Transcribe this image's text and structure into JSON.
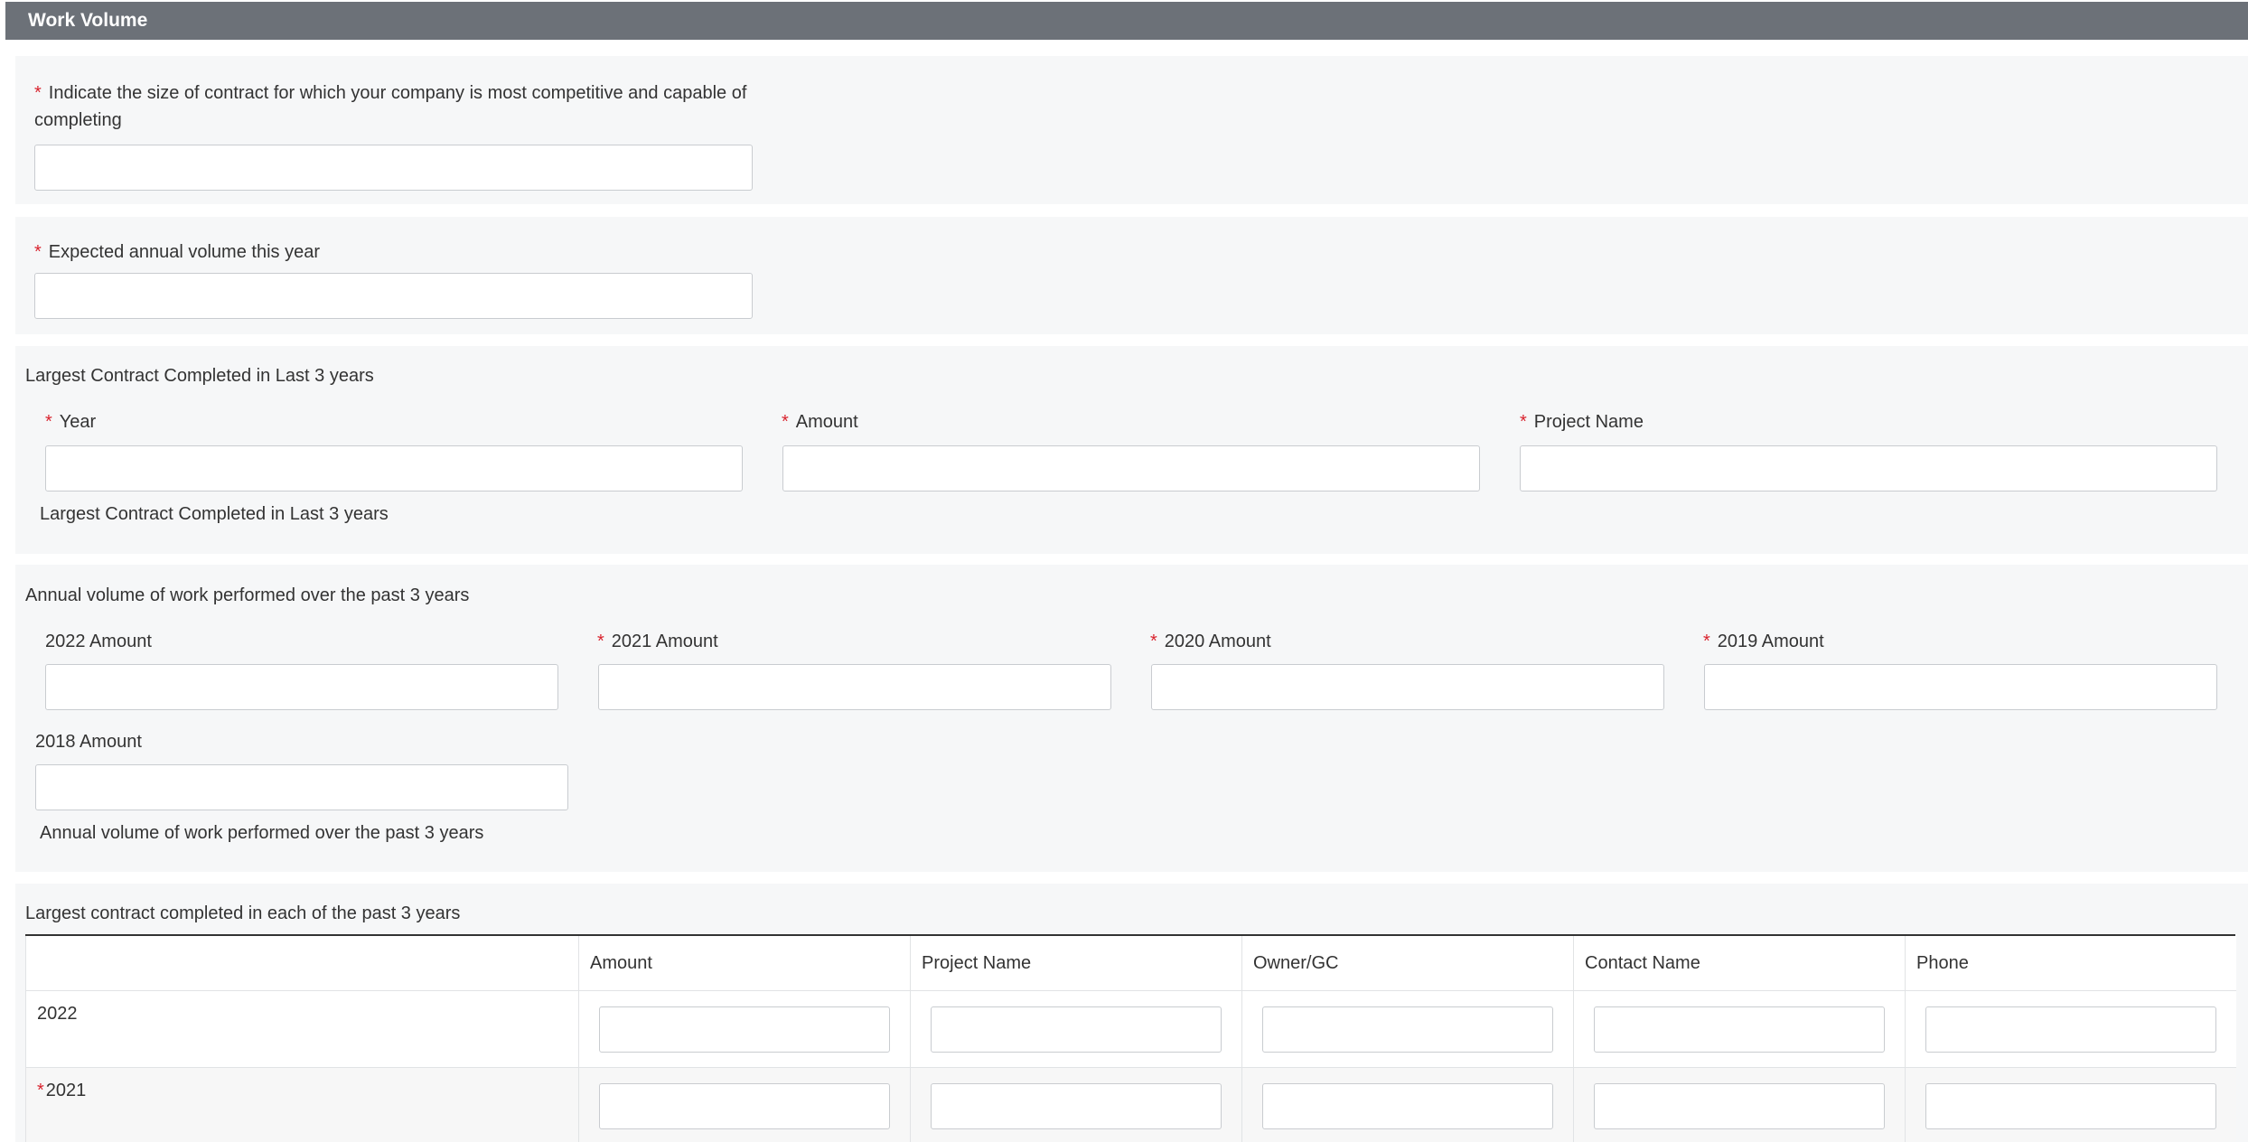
{
  "section": {
    "title": "Work Volume"
  },
  "contract_size": {
    "label": "Indicate the size of contract for which your company is most competitive and capable of completing",
    "value": ""
  },
  "annual_volume": {
    "label": "Expected annual volume this year",
    "value": ""
  },
  "largest_contract": {
    "title": "Largest Contract Completed in Last 3 years",
    "year_label": "Year",
    "amount_label": "Amount",
    "project_label": "Project Name",
    "help_text": "Largest Contract Completed in Last 3 years"
  },
  "annual_work": {
    "title": "Annual volume of work performed over the past 3 years",
    "amount_2022_label": "2022 Amount",
    "amount_2021_label": "2021 Amount",
    "amount_2020_label": "2020 Amount",
    "amount_2019_label": "2019 Amount",
    "amount_2018_label": "2018 Amount",
    "help_text": "Annual volume of work performed over the past 3 years"
  },
  "contracts_table": {
    "title": "Largest contract completed in each of the past 3 years",
    "columns": [
      "",
      "Amount",
      "Project Name",
      "Owner/GC",
      "Contact Name",
      "Phone"
    ],
    "rows": [
      {
        "year": "2022",
        "required": false
      },
      {
        "year": "2021",
        "required": true
      }
    ]
  },
  "required_marker": "*",
  "colors": {
    "header_bg": "#6c7178",
    "panel_bg": "#f6f7f8",
    "required": "#d9232e",
    "input_border": "#c9ccd0"
  }
}
